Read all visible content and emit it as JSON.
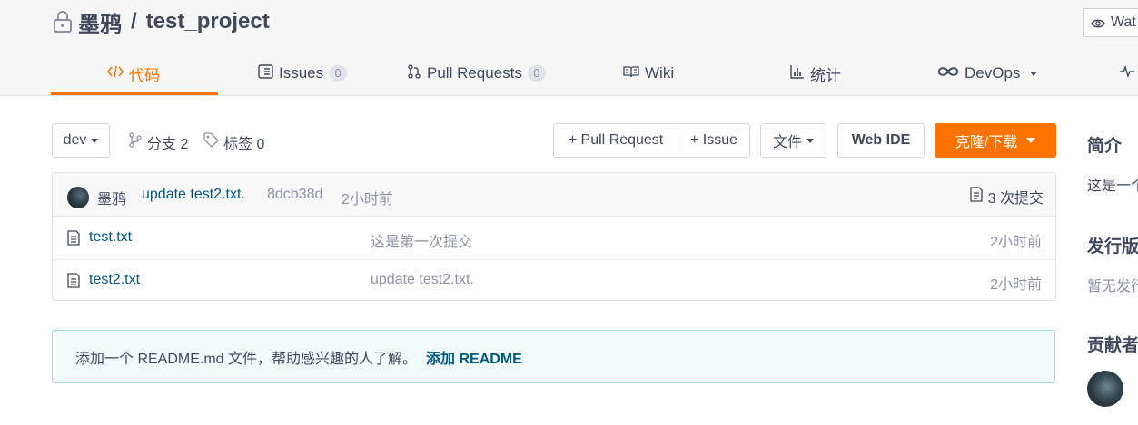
{
  "repo": {
    "owner": "墨鸦",
    "separator": "/",
    "name": "test_project",
    "lock_icon": "lock-icon"
  },
  "watch_button": {
    "label": "Wat",
    "icon": "eye-icon"
  },
  "tabs": [
    {
      "label": "代码",
      "icon": "code-icon",
      "active": true
    },
    {
      "label": "Issues",
      "count": "0",
      "icon": "issues-icon"
    },
    {
      "label": "Pull Requests",
      "count": "0",
      "icon": "pull-request-icon"
    },
    {
      "label": "Wiki",
      "icon": "wiki-book-icon"
    },
    {
      "label": "统计",
      "icon": "stats-bar-icon"
    },
    {
      "label": "DevOps",
      "icon": "infinity-icon",
      "dropdown": true
    },
    {
      "label": "",
      "icon": "pulse-icon"
    }
  ],
  "toolbar": {
    "branch": "dev",
    "branches_label": "分支 2",
    "tags_label": "标签 0",
    "new_pr": "+ Pull Request",
    "new_issue": "+ Issue",
    "file_menu": "文件",
    "web_ide": "Web IDE",
    "clone": "克隆/下载"
  },
  "latest_commit": {
    "author": "墨鸦",
    "message": "update test2.txt.",
    "sha": "8dcb38d",
    "time": "2小时前",
    "count_label": "3 次提交"
  },
  "files": [
    {
      "name": "test.txt",
      "message": "这是第一次提交",
      "time": "2小时前"
    },
    {
      "name": "test2.txt",
      "message": "update test2.txt.",
      "time": "2小时前"
    }
  ],
  "readme_banner": {
    "text": "添加一个 README.md 文件，帮助感兴趣的人了解。",
    "link": "添加 README"
  },
  "sidebar": {
    "intro_title": "简介",
    "intro_text": "这是一个",
    "releases_title": "发行版",
    "releases_text": "暂无发行",
    "contributors_title": "贡献者"
  },
  "colors": {
    "accent": "#fe7300",
    "link": "#005980",
    "muted": "#8c92a4",
    "text": "#40485b"
  }
}
